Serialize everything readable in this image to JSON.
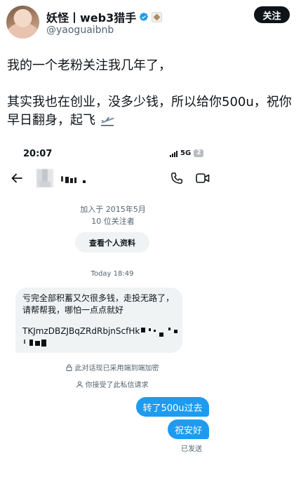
{
  "author": {
    "name": "妖怪丨web3猎手",
    "handle": "@yaoguaibnb"
  },
  "follow_label": "关注",
  "tweet": {
    "line1": "我的一个老粉关注我几年了，",
    "line2": "其实我也在创业，没多少钱，所以给你500u，祝你",
    "line3": "早日翻身，起飞"
  },
  "chat": {
    "status_time": "20:07",
    "network": "5G",
    "battery": "2",
    "joined": "加入于 2015年5月",
    "followers": "10 位关注者",
    "profile_button": "查看个人资料",
    "day_time": "Today 18:49",
    "incoming_message": "亏完全部积蓄又欠很多钱，走投无路了，请帮帮我，哪怕一点点就好",
    "incoming_address": "TKJmzDBZJBqZRdRbjnScfHk",
    "encryption_note": "此对话现已采用端到端加密",
    "accepted_note": "你接受了此私信请求",
    "outgoing": [
      "转了500u过去",
      "祝安好"
    ],
    "sent_status": "已发送"
  },
  "colors": {
    "accent_blue": "#1d9bf0",
    "incoming_bubble": "#eff3f4",
    "secondary_text": "#536471"
  }
}
